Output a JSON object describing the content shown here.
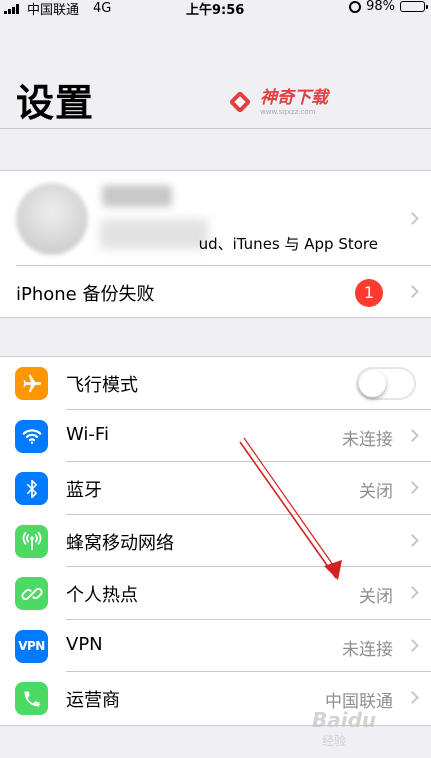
{
  "status_bar": {
    "carrier": "中国联通",
    "network": "4G",
    "time": "上午9:56",
    "battery": "98%",
    "battery_level": 0.98
  },
  "header": {
    "title": "设置"
  },
  "watermark": {
    "text": "神奇下载",
    "url": "www.sqxzz.com"
  },
  "account": {
    "subtitle": "ud、iTunes 与 App Store",
    "backup_label": "iPhone 备份失败",
    "backup_badge": "1"
  },
  "settings": {
    "airplane": {
      "label": "飞行模式",
      "icon": "airplane-icon",
      "color": "#ff9500",
      "on": false
    },
    "wifi": {
      "label": "Wi-Fi",
      "value": "未连接",
      "icon": "wifi-icon",
      "color": "#007aff"
    },
    "bluetooth": {
      "label": "蓝牙",
      "value": "关闭",
      "icon": "bluetooth-icon",
      "color": "#007aff"
    },
    "cellular": {
      "label": "蜂窝移动网络",
      "icon": "cellular-icon",
      "color": "#4cd964"
    },
    "hotspot": {
      "label": "个人热点",
      "value": "关闭",
      "icon": "hotspot-icon",
      "color": "#4cd964"
    },
    "vpn": {
      "label": "VPN",
      "value": "未连接",
      "icon_text": "VPN",
      "icon": "vpn-icon",
      "color": "#007aff"
    },
    "carrier": {
      "label": "运营商",
      "value": "中国联通",
      "icon": "phone-icon",
      "color": "#4cd964"
    }
  },
  "overlay": {
    "baidu_watermark": "Baidu",
    "baidu_sub": "经验"
  }
}
